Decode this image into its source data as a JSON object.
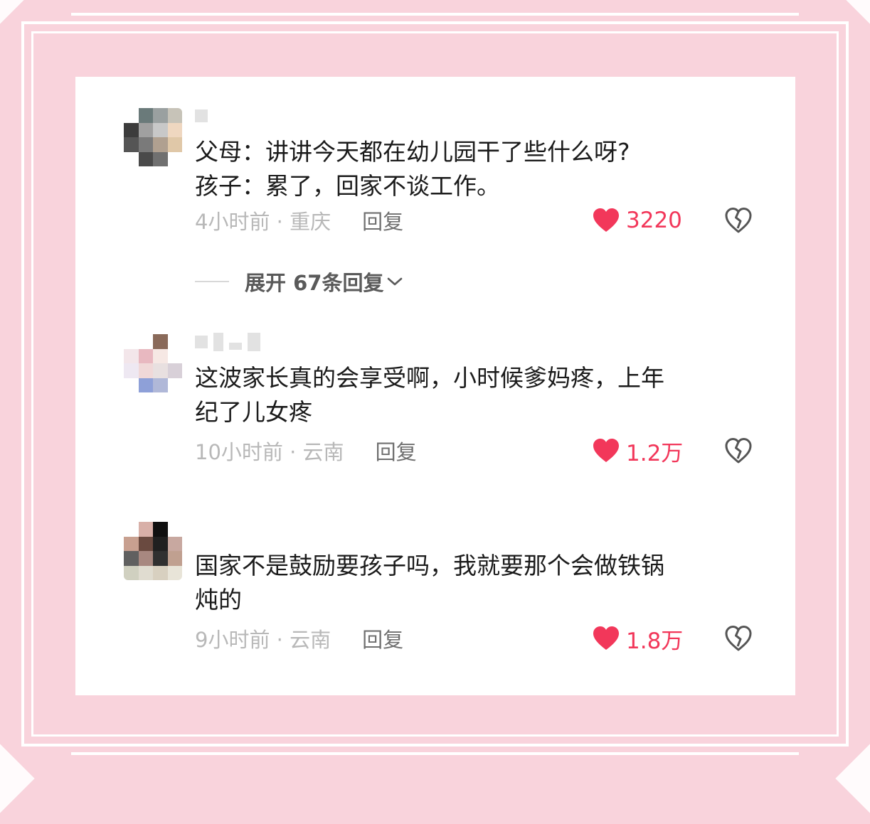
{
  "comments": [
    {
      "text": "父母：讲讲今天都在幼儿园干了些什么呀?\n孩子：累了，回家不谈工作。",
      "time_location": "4小时前 · 重庆",
      "reply_label": "回复",
      "likes": "3220",
      "expand_label": "展开 67条回复",
      "avatar_colors": [
        "#ffffff",
        "#6a7a7a",
        "#9aa0a0",
        "#c7c3b8",
        "#3c3c3c",
        "#a0a0a0",
        "#c8c8c8",
        "#efd7c0",
        "#555555",
        "#7a7a7a",
        "#b0a090",
        "#e0c8a8",
        "#ffffff",
        "#4a4a4a",
        "#707070",
        "#ffffff"
      ]
    },
    {
      "text": "这波家长真的会享受啊，小时候爹妈疼，上年\n纪了儿女疼",
      "time_location": "10小时前 · 云南",
      "reply_label": "回复",
      "likes": "1.2万",
      "avatar_colors": [
        "#ffffff",
        "#ffffff",
        "#8a6a5a",
        "#ffffff",
        "#f3e6ea",
        "#e8b8c0",
        "#f6e8e4",
        "#ffffff",
        "#eee8f2",
        "#f0d8d8",
        "#e8e0e0",
        "#d8d0d8",
        "#ffffff",
        "#8ea0d8",
        "#b0b8d8",
        "#ffffff"
      ]
    },
    {
      "text": "国家不是鼓励要孩子吗，我就要那个会做铁锅\n炖的",
      "time_location": "9小时前 · 云南",
      "reply_label": "回复",
      "likes": "1.8万",
      "avatar_colors": [
        "#ffffff",
        "#d8b0a8",
        "#101010",
        "#ffffff",
        "#c8a090",
        "#6a4a40",
        "#202020",
        "#c8a8a0",
        "#606060",
        "#a88880",
        "#303030",
        "#c0a090",
        "#d0d0c0",
        "#e0dcd0",
        "#d8d0c0",
        "#e8e4d8"
      ]
    }
  ],
  "colors": {
    "like": "#f2375a",
    "muted": "#b8b8b8",
    "frame": "#f9d3dc"
  },
  "icons": {
    "like": "heart-filled-icon",
    "dislike": "broken-heart-icon",
    "expand": "chevron-down-icon"
  }
}
